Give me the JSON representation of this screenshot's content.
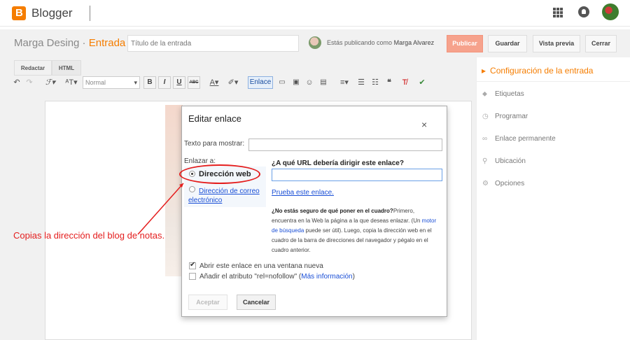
{
  "app": {
    "brand": "Blogger",
    "logo_letter": "B",
    "brand_color": "#f57d00"
  },
  "post": {
    "blog_name": "Marga Desing",
    "separator": " · ",
    "entry_label": "Entrada",
    "title_placeholder": "Título de la entrada",
    "publishing_as": "Estás publicando como",
    "author": "Marga Alvarez",
    "buttons": {
      "publish": "Publicar",
      "save": "Guardar",
      "preview": "Vista previa",
      "close": "Cerrar"
    }
  },
  "editor": {
    "tabs": [
      "Redactar",
      "HTML"
    ],
    "font_select": "Normal",
    "format_bold": "B",
    "format_italic": "I",
    "format_underline": "U",
    "format_strike": "ABC",
    "link_button": "Enlace",
    "icons": [
      "undo-icon",
      "redo-icon",
      "font-family-icon",
      "font-size-icon",
      "text-color-icon",
      "highlight-icon",
      "image-icon",
      "video-icon",
      "emoji-icon",
      "jump-break-icon",
      "align-icon",
      "numbered-list-icon",
      "bullet-list-icon",
      "quote-icon",
      "clear-format-icon",
      "spellcheck-icon"
    ]
  },
  "settings": {
    "title": "Configuración de la entrada",
    "items": [
      {
        "label": "Etiquetas",
        "icon": "tag-icon"
      },
      {
        "label": "Programar",
        "icon": "clock-icon"
      },
      {
        "label": "Enlace permanente",
        "icon": "link-icon"
      },
      {
        "label": "Ubicación",
        "icon": "location-pin-icon"
      },
      {
        "label": "Opciones",
        "icon": "gear-icon"
      }
    ]
  },
  "dialog": {
    "title": "Editar enlace",
    "close": "×",
    "text_to_display_label": "Texto para mostrar:",
    "link_to_label": "Enlazar a:",
    "option_web": "Dirección web",
    "option_email": "Dirección de correo electrónico",
    "url_question": "¿A qué URL debería dirigir este enlace?",
    "test_link": "Prueba este enlace.",
    "help_bold": "¿No estás seguro de qué poner en el cuadro?",
    "help_1": "Primero, encuentra en la Web la página a la que deseas enlazar. (Un ",
    "help_link": "motor de búsqueda",
    "help_2": " puede ser útil). Luego, copia la dirección web en el cuadro de la barra de direcciones del navegador y pégalo en el cuadro anterior.",
    "open_new_window": "Abrir este enlace en una ventana nueva",
    "nofollow_prefix": "Añadir el atributo \"rel=nofollow\" (",
    "nofollow_link": "Más información",
    "nofollow_suffix": ")",
    "accept": "Aceptar",
    "cancel": "Cancelar"
  },
  "annotation": {
    "text": "Copias la dirección del blog de notas.",
    "color": "#e41d1d"
  }
}
